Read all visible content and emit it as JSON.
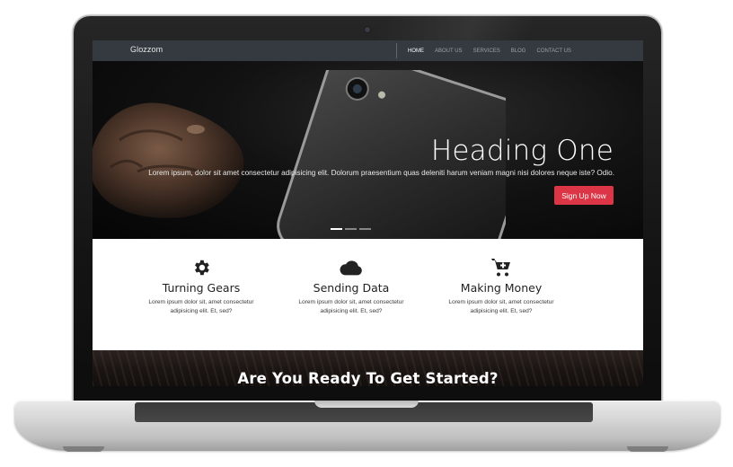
{
  "navbar": {
    "brand": "Glozzom",
    "links": [
      "HOME",
      "ABOUT US",
      "SERVICES",
      "BLOG",
      "CONTACT US"
    ],
    "active_link": "HOME"
  },
  "hero": {
    "heading": "Heading One",
    "text": "Lorem ipsum, dolor sit amet consectetur adipisicing elit. Dolorum praesentium quas deleniti harum veniam magni nisi dolores neque iste? Odio.",
    "button_label": "Sign Up Now",
    "button_color": "#dc3545",
    "slides": 3,
    "active_slide": 1
  },
  "features": [
    {
      "icon": "gear-icon",
      "title": "Turning Gears",
      "text": "Lorem ipsum dolor sit, amet consectetur adipisicing elit. Et, sed?"
    },
    {
      "icon": "cloud-icon",
      "title": "Sending Data",
      "text": "Lorem ipsum dolor sit, amet consectetur adipisicing elit. Et, sed?"
    },
    {
      "icon": "cart-plus-icon",
      "title": "Making Money",
      "text": "Lorem ipsum dolor sit, amet consectetur adipisicing elit. Et, sed?"
    }
  ],
  "cta": {
    "title": "Are You Ready To Get Started?"
  },
  "colors": {
    "navbar_bg": "#343a40",
    "accent": "#dc3545",
    "laptop_silver": "#d7d7d7"
  }
}
